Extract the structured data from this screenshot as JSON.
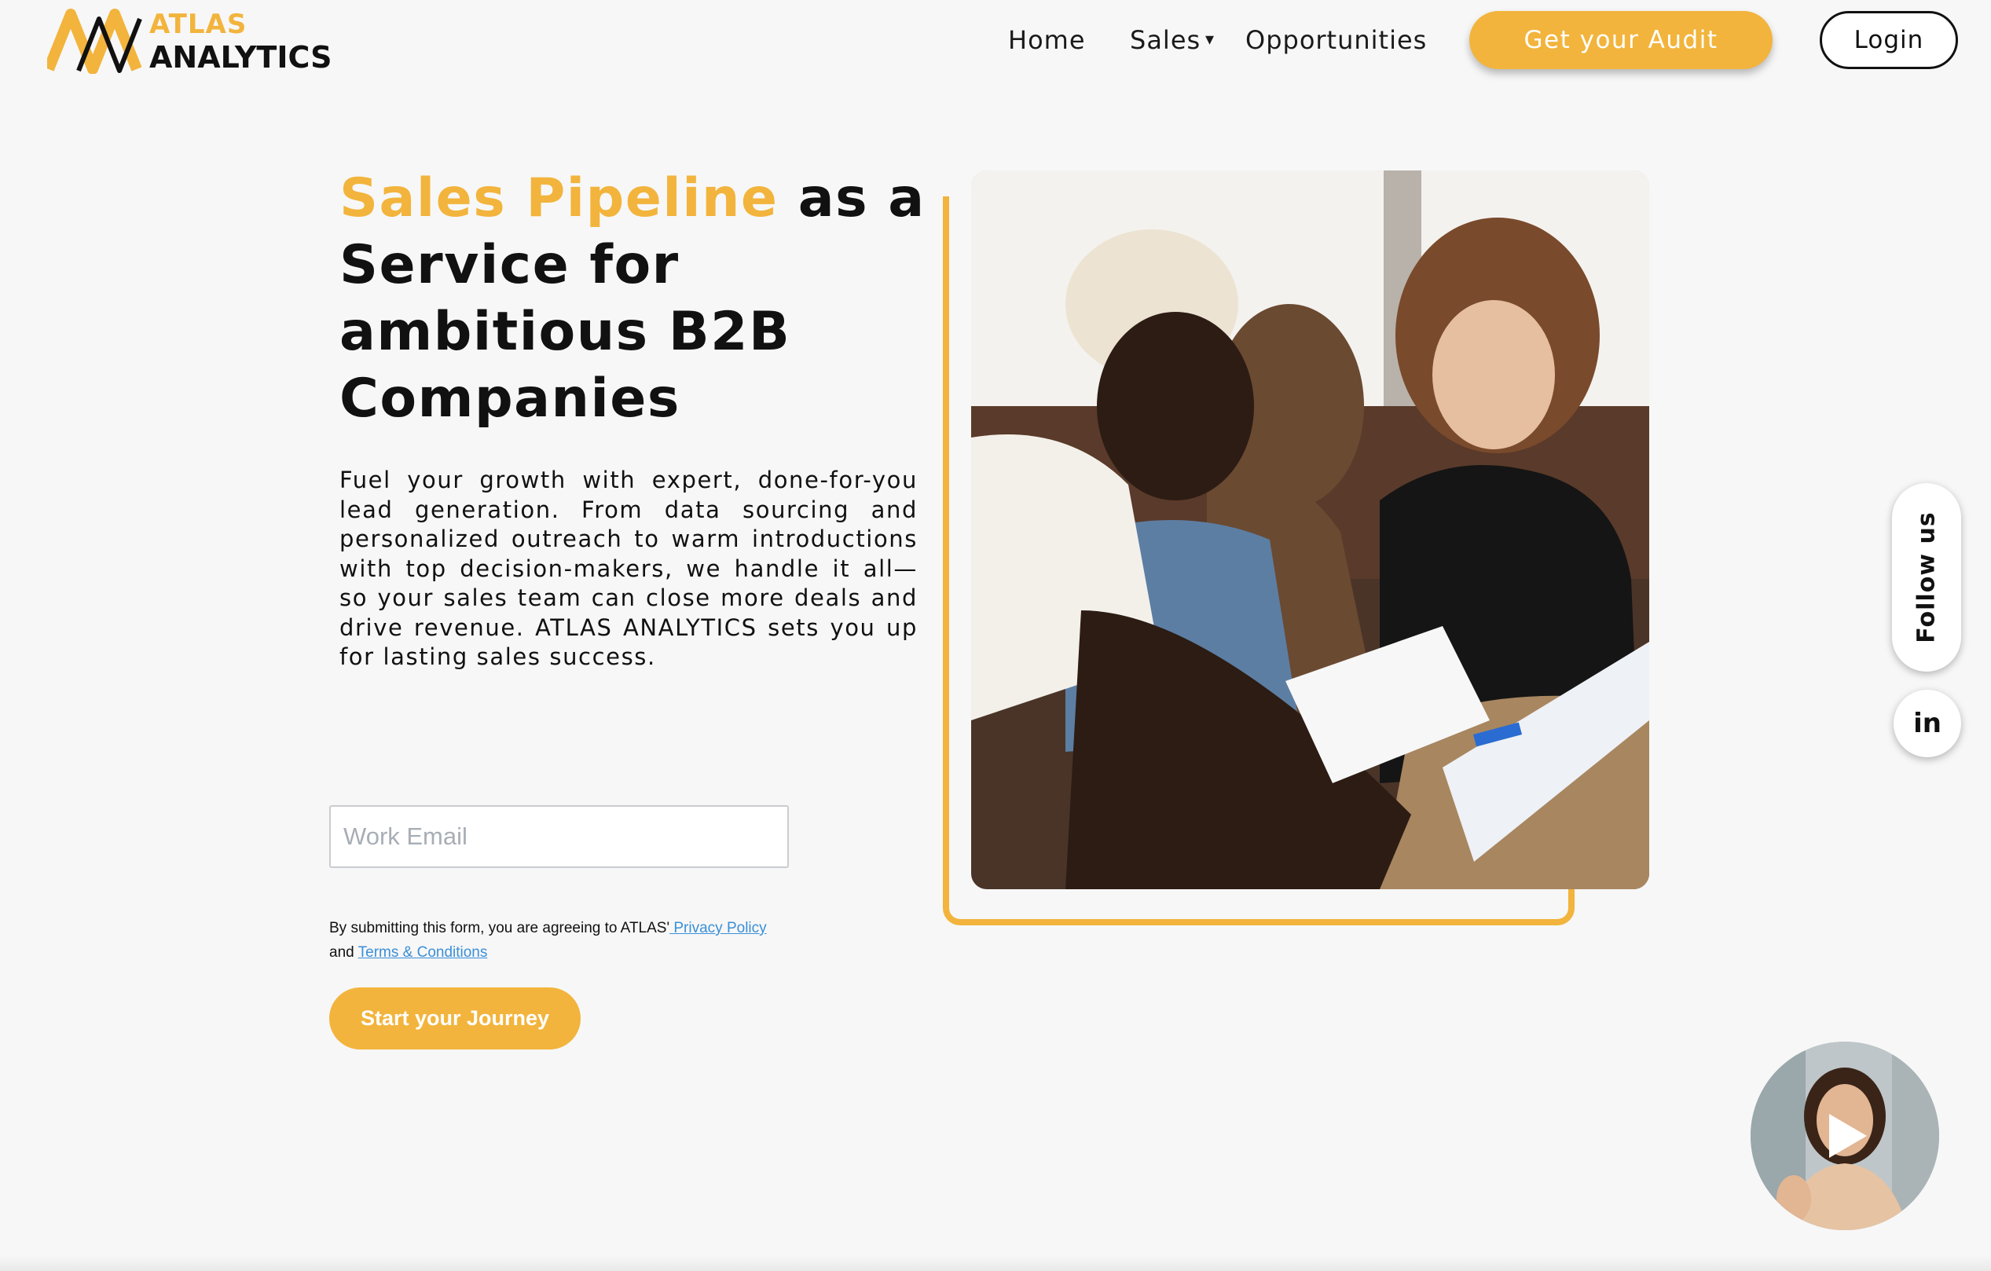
{
  "brand": {
    "line1": "ATLAS",
    "line2": "ANALYTICS",
    "accent_color": "#f2b43c",
    "text_color": "#111111"
  },
  "nav": {
    "home": "Home",
    "sales": "Sales",
    "sales_caret": "▾",
    "opportunities": "Opportunities",
    "audit_button": "Get your Audit",
    "login_button": "Login"
  },
  "hero": {
    "title_accent": "Sales Pipeline",
    "title_rest": " as a Service for ambitious B2B Companies",
    "description": "Fuel your growth with expert, done-for-you lead generation. From data sourcing and personalized outreach to warm introductions with top decision-makers, we handle it all—so your sales team can close more deals and drive revenue. ATLAS ANALYTICS sets you up for lasting sales success."
  },
  "form": {
    "email_placeholder": "Work Email",
    "consent_prefix": "By submitting this form, you are agreeing to ATLAS'",
    "privacy_link": " Privacy Policy",
    "consent_and": "and ",
    "terms_link": "Terms & Conditions",
    "submit_button": "Start your Journey"
  },
  "social": {
    "follow_label": "Follow us",
    "linkedin_label": "in"
  },
  "icons": {
    "logo": "atlas-mountain-logo-icon",
    "caret": "chevron-down-icon",
    "linkedin": "linkedin-icon",
    "play": "play-icon"
  }
}
